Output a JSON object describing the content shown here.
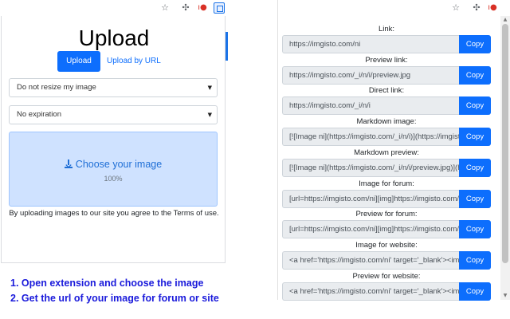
{
  "popup": {
    "title": "Upload",
    "upload_button": "Upload",
    "upload_by_url": "Upload by URL",
    "resize_select": "Do not resize my image",
    "expiration_select": "No expiration",
    "dropzone_label": "Choose your image",
    "progress": "100%",
    "terms": "By uploading images to our site you agree to the Terms of use."
  },
  "instructions": [
    "1. Open extension and choose the image",
    "2. Get the url of your image for forum or site"
  ],
  "toolbar_icons": [
    "star-icon",
    "extension-icon",
    "record-icon",
    "active-extension-icon"
  ],
  "copy_label": "Copy",
  "fields": [
    {
      "label": "Link:",
      "value": "https://imgisto.com/ni"
    },
    {
      "label": "Preview link:",
      "value": "https://imgisto.com/_i/n/i/preview.jpg"
    },
    {
      "label": "Direct link:",
      "value": "https://imgisto.com/_i/n/i"
    },
    {
      "label": "Markdown image:",
      "value": "[![Image ni](https://imgisto.com/_i/n/i)](https://imgisto.com/ni)"
    },
    {
      "label": "Markdown preview:",
      "value": "[![Image ni](https://imgisto.com/_i/n/i/preview.jpg)](https://imgisto.com/ni)"
    },
    {
      "label": "Image for forum:",
      "value": "[url=https://imgisto.com/ni][img]https://imgisto.com/_i/n/i[/img][/url]"
    },
    {
      "label": "Preview for forum:",
      "value": "[url=https://imgisto.com/ni][img]https://imgisto.com/_i/n/i/preview.jpg[/img][/url]"
    },
    {
      "label": "Image for website:",
      "value": "<a href='https://imgisto.com/ni' target='_blank'><img src='https://imgisto.com/_i/n/i'></a>"
    },
    {
      "label": "Preview for website:",
      "value": "<a href='https://imgisto.com/ni' target='_blank'><img src='https://imgisto.com/_i/n/i/preview.jpg'></a>"
    }
  ],
  "colors": {
    "primary": "#0d6efd",
    "dropzone": "#cfe2ff",
    "instructions": "#1a1adb",
    "readonly_field": "#e9ecef"
  }
}
